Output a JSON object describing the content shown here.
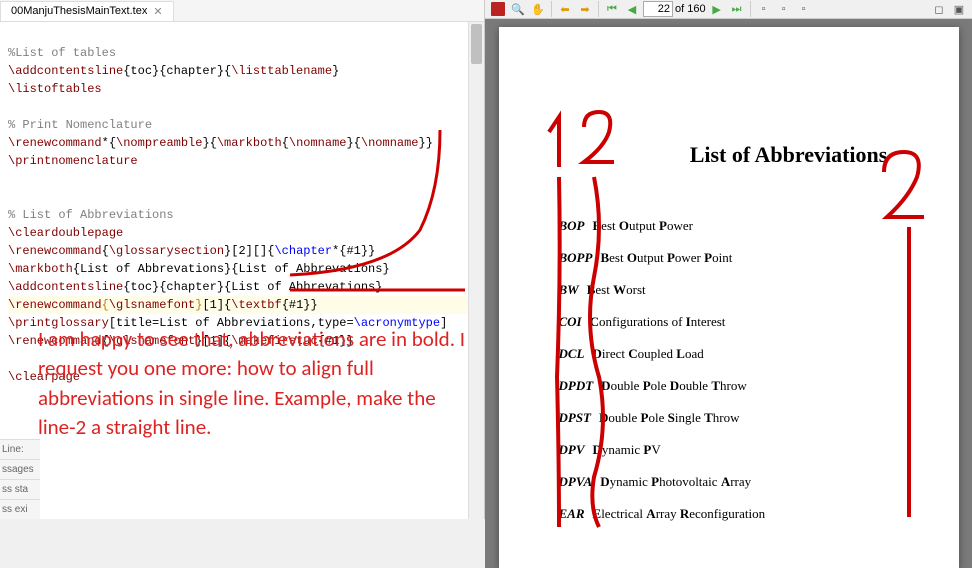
{
  "editor": {
    "filename": "00ManjuThesisMainText.tex",
    "line_label": "Line:",
    "status1": "ssages",
    "status2": "ss sta",
    "status3": "ss exi",
    "code": {
      "l1c": "%List of tables",
      "l2a": "\\addcontentsline",
      "l2b": "{toc}{chapter}{",
      "l2c": "\\listtablename",
      "l2d": "}",
      "l3": "\\listoftables",
      "l5": "% Print Nomenclature",
      "l6a": "\\renewcommand",
      "l6b": "*{",
      "l6c": "\\nompreamble",
      "l6d": "}{",
      "l6e": "\\markboth",
      "l6f": "{",
      "l6g": "\\nomname",
      "l6h": "}{",
      "l6i": "\\nomname",
      "l6j": "}}",
      "l7": "\\printnomenclature",
      "l10": "% List of Abbreviations",
      "l11": "\\cleardoublepage",
      "l12a": "\\renewcommand",
      "l12b": "{",
      "l12c": "\\glossarysection",
      "l12d": "}[2][]{",
      "l12e": "\\chapter",
      "l12f": "*{#1}}",
      "l13a": "\\markboth",
      "l13b": "{List of Abbrevations}{List of Abbrevations}",
      "l14a": "\\addcontentsline",
      "l14b": "{toc}{chapter}{List of Abbrevations}",
      "l15a": "\\renewcommand",
      "l15b": "{",
      "l15c": "\\glsnamefont",
      "l15d": "}",
      "l15e": "[1]{",
      "l15f": "\\textbf",
      "l15g": "{#1}}",
      "l16a": "\\printglossary",
      "l16b": "[title=List of Abbreviations,type=",
      "l16c": "\\acronymtype",
      "l16d": "]",
      "l17a": "\\renewcommand",
      "l17b": "{",
      "l17c": "\\glsnamefont",
      "l17d": "}[1]{",
      "l17e": "\\makefirstuc",
      "l17f": "{#1}}",
      "l19": "\\clearpage"
    }
  },
  "annotation_text": "I am happy to see that, abbreviations are in bold. I request you one more: how to align full abbreviations in single line. Example, make the line-2 a straight line.",
  "pdf": {
    "page_current": "22",
    "page_total": "of 160",
    "title": "List of Abbreviations",
    "abbreviations": [
      {
        "term": "BOP",
        "def": "<b>B</b>est <b>O</b>utput <b>P</b>ower"
      },
      {
        "term": "BOPP",
        "def": "<b>B</b>est <b>O</b>utput <b>P</b>ower <b>P</b>oint"
      },
      {
        "term": "BW",
        "def": "<b>B</b>est <b>W</b>orst"
      },
      {
        "term": "COI",
        "def": "<b>C</b>onfigurations of <b>I</b>nterest"
      },
      {
        "term": "DCL",
        "def": "<b>D</b>irect <b>C</b>oupled <b>L</b>oad"
      },
      {
        "term": "DPDT",
        "def": "<b>D</b>ouble <b>P</b>ole <b>D</b>ouble <b>T</b>hrow"
      },
      {
        "term": "DPST",
        "def": "<b>D</b>ouble <b>P</b>ole <b>S</b>ingle <b>T</b>hrow"
      },
      {
        "term": "DPV",
        "def": "<b>D</b>ynamic <b>P</b>V"
      },
      {
        "term": "DPVA",
        "def": "<b>D</b>ynamic <b>P</b>hotovoltaic <b>A</b>rray"
      },
      {
        "term": "EAR",
        "def": "<b>E</b>lectrical <b>A</b>rray <b>R</b>econfiguration"
      }
    ]
  },
  "red_labels": {
    "one": "1",
    "two_a": "2",
    "two_b": "2"
  }
}
